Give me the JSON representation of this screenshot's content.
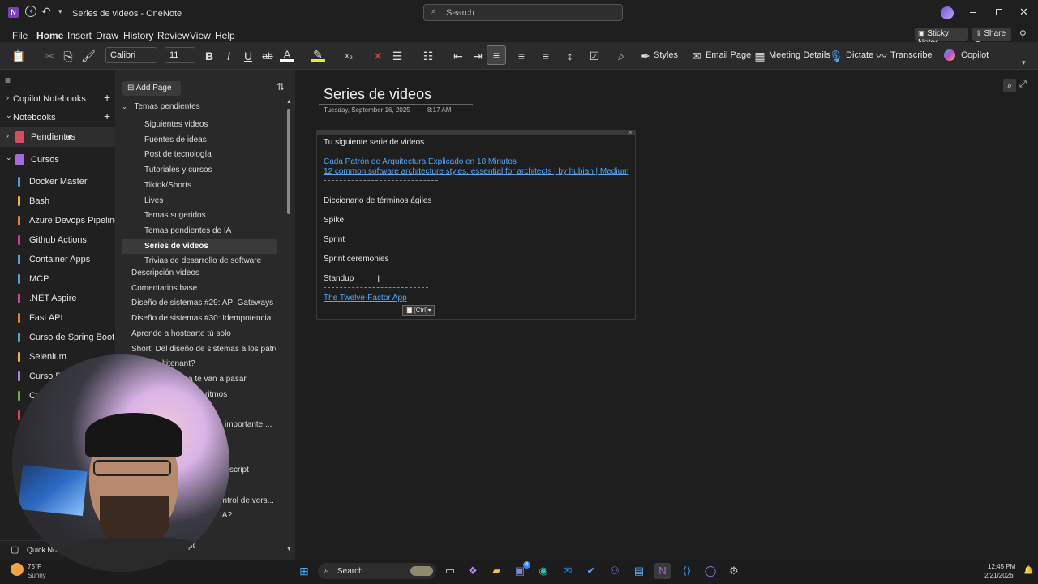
{
  "window": {
    "title": "Series de videos  -  OneNote",
    "search_placeholder": "Search"
  },
  "menu": [
    "File",
    "Home",
    "Insert",
    "Draw",
    "History",
    "Review",
    "View",
    "Help"
  ],
  "menu_active": "Home",
  "header_buttons": {
    "sticky": "Sticky Notes",
    "share": "Share"
  },
  "ribbon": {
    "font": "Calibri",
    "size": "11",
    "styles": "Styles",
    "email": "Email Page",
    "meeting": "Meeting Details",
    "dictate": "Dictate",
    "transcribe": "Transcribe",
    "copilot": "Copilot"
  },
  "nav": {
    "copilot_notebooks": "Copilot Notebooks",
    "notebooks": "Notebooks",
    "pendientes": "Pendientes",
    "cursos": "Cursos",
    "sections": [
      {
        "label": "Docker Master",
        "color": "#5b9bd5"
      },
      {
        "label": "Bash",
        "color": "#e8b93c"
      },
      {
        "label": "Azure Devops Pipelines",
        "color": "#ed7d31"
      },
      {
        "label": "Github Actions",
        "color": "#c8419a"
      },
      {
        "label": "Container Apps",
        "color": "#4fa3d9"
      },
      {
        "label": "MCP",
        "color": "#4fa3d9"
      },
      {
        "label": ".NET Aspire",
        "color": "#c8419a"
      },
      {
        "label": "Fast API",
        "color": "#ed7d31"
      },
      {
        "label": "Curso de Spring Boot",
        "color": "#4fa3d9"
      },
      {
        "label": "Selenium",
        "color": "#e8b93c"
      },
      {
        "label": "Curso Dja",
        "color": "#b180d7"
      },
      {
        "label": "Co",
        "color": "#70ad47"
      },
      {
        "label": "",
        "color": "#e04050"
      }
    ],
    "quick_notes": "Quick Note"
  },
  "pages": {
    "add_page": "Add Page",
    "group": "Temas pendientes",
    "subpages": [
      "Siguientes videos",
      "Fuentes de ideas",
      "Post de tecnología",
      "Tutoriales y cursos",
      "Tiktok/Shorts",
      "Lives",
      "Temas sugeridos",
      "Temas pendientes de IA",
      "Series de videos",
      "Trivias de desarrollo de software"
    ],
    "active": "Series de videos",
    "toplevel": [
      "Descripción videos",
      "Comentarios base",
      "Diseño de sistemas #29: API Gateways",
      "Diseño de sistemas #30: Idempotencia",
      "Aprende a hostearte tú solo",
      "Short: Del diseño de sistemas a los patrones ..."
    ],
    "partial": [
      "ltitenant?",
      "ca te van a pasar como i...",
      "ritmos",
      "importante ...",
      "script",
      "ontrol de vers...",
      "IA?",
      "pt"
    ]
  },
  "note": {
    "title": "Series de videos",
    "date": "Tuesday, September 16, 2025",
    "time": "8:17 AM",
    "heading": "Tu siguiente serie de videos",
    "link1": "Cada Patrón de Arquitectura Explicado en 18 Minutos",
    "link2": "12 common software architecture styles, essential for architects | by hubian | Medium",
    "dict": "Diccionario de términos ágiles",
    "terms": [
      "Spike",
      "Sprint",
      "Sprint ceremonies",
      "Standup"
    ],
    "link3": "The Twelve-Factor App",
    "paste": "(Ctrl)"
  },
  "taskbar": {
    "temp": "75°F",
    "weather": "Sunny",
    "search": "Search",
    "time": "12:45 PM",
    "date": "2/21/2026",
    "badge": "4"
  }
}
